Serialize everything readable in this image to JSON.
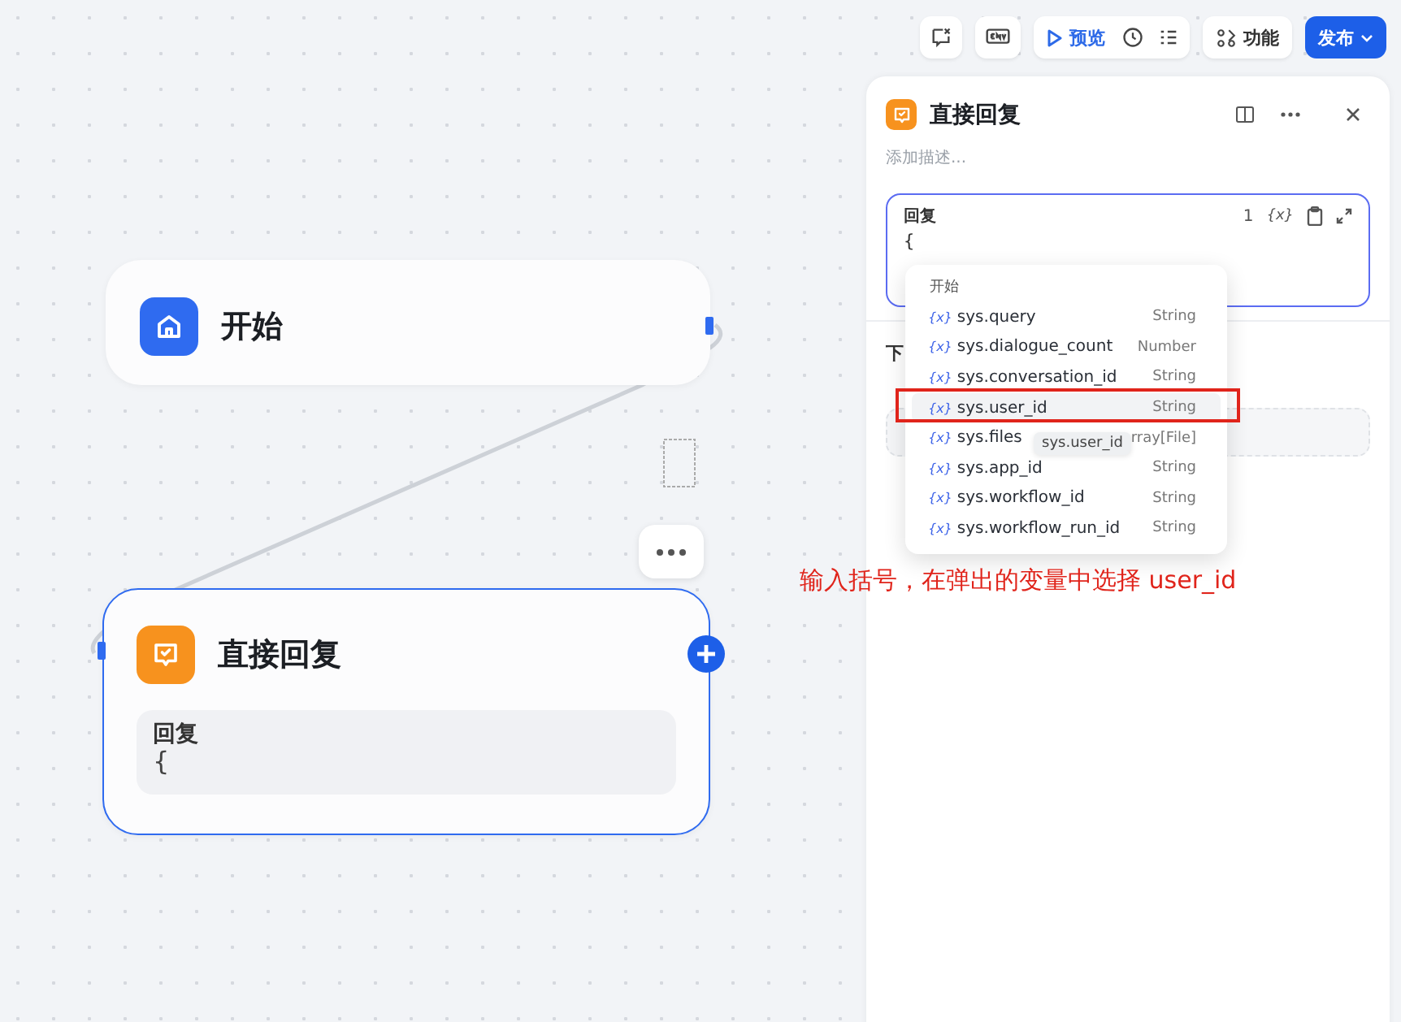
{
  "toolbar": {
    "preview": "预览",
    "features": "功能",
    "publish": "发布"
  },
  "canvas": {
    "nodes": [
      {
        "kind": "start",
        "title": "开始",
        "selected": false
      },
      {
        "kind": "answer",
        "title": "直接回复",
        "selected": true,
        "field_label": "回复",
        "field_value": "{"
      }
    ]
  },
  "panel": {
    "title": "直接回复",
    "description_placeholder": "添加描述...",
    "reply": {
      "label": "回复",
      "count": "1",
      "variable_button": "{x}",
      "value": "{"
    },
    "next_step": "下"
  },
  "variable_menu": {
    "group": "开始",
    "items": [
      {
        "icon": "{x}",
        "name": "sys.query",
        "type": "String",
        "selected": false
      },
      {
        "icon": "{x}",
        "name": "sys.dialogue_count",
        "type": "Number",
        "selected": false
      },
      {
        "icon": "{x}",
        "name": "sys.conversation_id",
        "type": "String",
        "selected": false
      },
      {
        "icon": "{x}",
        "name": "sys.user_id",
        "type": "String",
        "selected": true
      },
      {
        "icon": "{x}",
        "name": "sys.files",
        "type": "rray[File]",
        "selected": false,
        "tooltip": "sys.user_id"
      },
      {
        "icon": "{x}",
        "name": "sys.app_id",
        "type": "String",
        "selected": false
      },
      {
        "icon": "{x}",
        "name": "sys.workflow_id",
        "type": "String",
        "selected": false
      },
      {
        "icon": "{x}",
        "name": "sys.workflow_run_id",
        "type": "String",
        "selected": false
      }
    ]
  },
  "annotation": "输入括号，在弹出的变量中选择 user_id"
}
